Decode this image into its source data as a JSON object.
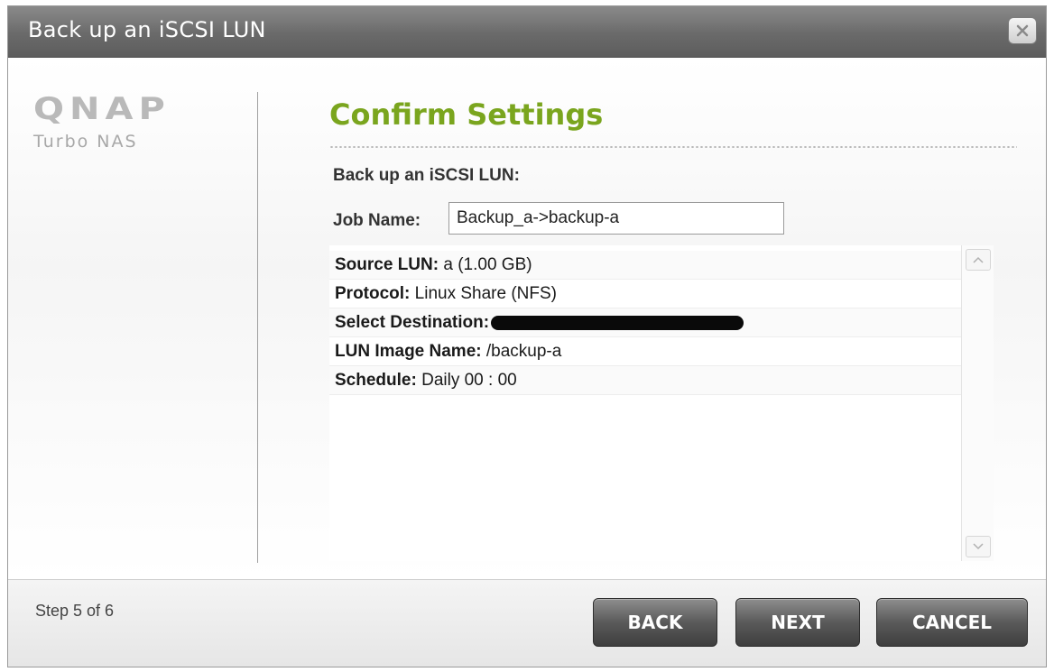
{
  "window": {
    "title": "Back up an iSCSI LUN"
  },
  "logo": {
    "brand": "QNAP",
    "sub": "Turbo NAS"
  },
  "main": {
    "heading": "Confirm Settings",
    "subheading": "Back up an iSCSI LUN:",
    "job_name_label": "Job Name:",
    "job_name_value": "Backup_a->backup-a"
  },
  "summary": {
    "rows": [
      {
        "label": "Source LUN:",
        "value": "a  (1.00 GB)"
      },
      {
        "label": "Protocol:",
        "value": "Linux Share (NFS)"
      },
      {
        "label": "Select Destination:",
        "value": ""
      },
      {
        "label": "LUN Image Name:",
        "value": "/backup-a"
      },
      {
        "label": "Schedule:",
        "value": "Daily 00 : 00"
      }
    ]
  },
  "footer": {
    "step": "Step 5 of 6",
    "back_label": "BACK",
    "next_label": "NEXT",
    "cancel_label": "CANCEL"
  },
  "icons": {
    "close": "close-icon",
    "scroll_up": "chevron-up-icon",
    "scroll_down": "chevron-down-icon"
  },
  "colors": {
    "heading_green": "#7aa51e",
    "titlebar": "#6a6a6a",
    "button_dark": "#4a4a4a"
  }
}
